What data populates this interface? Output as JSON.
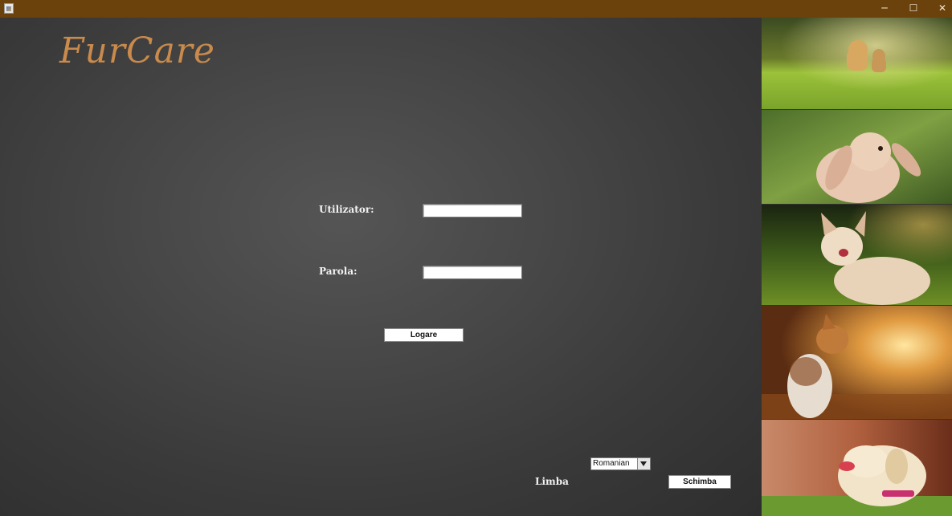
{
  "window": {
    "minimize": "─",
    "maximize": "☐",
    "close": "✕"
  },
  "app": {
    "brand": "FurCare"
  },
  "login": {
    "username_label": "Utilizator:",
    "username_value": "",
    "password_label": "Parola:",
    "password_value": "",
    "login_button": "Logare"
  },
  "language": {
    "label": "Limba",
    "selected": "Romanian",
    "change_button": "Schimba"
  },
  "colors": {
    "titlebar": "#6b420b",
    "brand": "#c98a4c",
    "background": "#3f3f3f"
  },
  "photos": [
    {
      "subject": "two dogs on grass"
    },
    {
      "subject": "rabbit"
    },
    {
      "subject": "kitten"
    },
    {
      "subject": "cat in sunset"
    },
    {
      "subject": "labrador dog"
    }
  ]
}
